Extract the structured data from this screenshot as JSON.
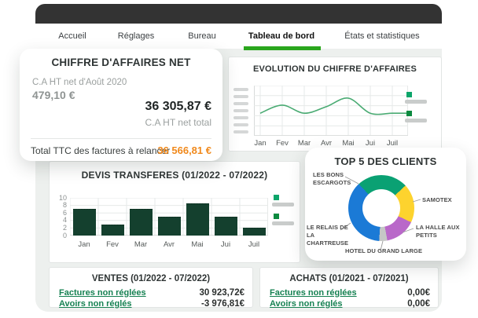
{
  "nav": {
    "tabs": [
      {
        "label": "Accueil",
        "active": false
      },
      {
        "label": "Réglages",
        "active": false
      },
      {
        "label": "Bureau",
        "active": false
      },
      {
        "label": "Tableau de bord",
        "active": true
      },
      {
        "label": "États et statistiques",
        "active": false
      }
    ]
  },
  "colors": {
    "accent_green": "#2aa61d",
    "orange": "#f0891c",
    "link_green": "#168152",
    "line_green": "#4aab73",
    "bar_green": "#14402e",
    "legend": [
      "#0ca56a",
      "#0c8a3f"
    ],
    "donut": [
      "#0aa173",
      "#fdd32e",
      "#b968c9",
      "#c5c7c6",
      "#1b7ad6"
    ]
  },
  "ca_card": {
    "title": "CHIFFRE D'AFFAIRES NET",
    "month_label": "C.A HT net d'Août 2020",
    "month_value": "479,10 €",
    "total_value": "36 305,87 €",
    "total_label": "C.A HT net total",
    "relance_label": "Total TTC des factures à relancer",
    "relance_value": "36 566,81 €"
  },
  "evolution": {
    "title": "EVOLUTION DU CHIFFRE D'AFFAIRES",
    "months": [
      "Jan",
      "Fev",
      "Mar",
      "Avr",
      "Mai",
      "Jui",
      "Juil"
    ],
    "values_relative": [
      0.45,
      0.61,
      0.45,
      0.58,
      0.75,
      0.45,
      0.45
    ]
  },
  "devis": {
    "title": "DEVIS TRANSFERES (01/2022 - 07/2022)",
    "months": [
      "Jan",
      "Fev",
      "Mar",
      "Avr",
      "Mai",
      "Jui",
      "Juil"
    ],
    "values": [
      7,
      3,
      7,
      5,
      8.5,
      5,
      2
    ],
    "yticks": [
      10,
      8,
      6,
      4,
      2,
      0
    ]
  },
  "top5": {
    "title": "TOP 5 DES CLIENTS",
    "clients": [
      {
        "name": "LES BONS ESCARGOTS",
        "color": "#0aa173",
        "pct": 25
      },
      {
        "name": "SAMOTEX",
        "color": "#fdd32e",
        "pct": 19
      },
      {
        "name": "LA HALLE AUX PETITS",
        "color": "#b968c9",
        "pct": 15
      },
      {
        "name": "HOTEL DU GRAND LARGE",
        "color": "#c5c7c6",
        "pct": 4
      },
      {
        "name": "LE RELAIS DE LA CHARTREUSE",
        "color": "#1b7ad6",
        "pct": 37
      }
    ]
  },
  "ventes": {
    "title": "VENTES (01/2022 - 07/2022)",
    "rows": [
      {
        "label": "Factures non réglées",
        "value": "30 923,72€"
      },
      {
        "label": "Avoirs non réglés",
        "value": "-3 976,81€"
      }
    ]
  },
  "achats": {
    "title": "ACHATS (01/2021 - 07/2021)",
    "rows": [
      {
        "label": "Factures non réglées",
        "value": "0,00€"
      },
      {
        "label": "Avoirs non réglés",
        "value": "0,00€"
      }
    ]
  },
  "chart_data": [
    {
      "type": "line",
      "title": "EVOLUTION DU CHIFFRE D'AFFAIRES",
      "x": [
        "Jan",
        "Fev",
        "Mar",
        "Avr",
        "Mai",
        "Jui",
        "Juil"
      ],
      "series": [
        {
          "name": "(legend text redacted as gray bar)",
          "values_relative": [
            0.45,
            0.61,
            0.45,
            0.58,
            0.75,
            0.45,
            0.45
          ]
        }
      ],
      "note": "y-axis tick labels and the two legend labels are redacted gray placeholder bars in the screenshot",
      "legend_position": "right",
      "grid": true
    },
    {
      "type": "bar",
      "title": "DEVIS TRANSFERES (01/2022 - 07/2022)",
      "categories": [
        "Jan",
        "Fev",
        "Mar",
        "Avr",
        "Mai",
        "Jui",
        "Juil"
      ],
      "values": [
        7,
        3,
        7,
        5,
        8.5,
        5,
        2
      ],
      "ylim": [
        0,
        10
      ],
      "yticks": [
        0,
        2,
        4,
        6,
        8,
        10
      ],
      "legend_position": "right",
      "grid": true
    },
    {
      "type": "pie",
      "title": "TOP 5 DES CLIENTS",
      "labels": [
        "LES BONS ESCARGOTS",
        "SAMOTEX",
        "LA HALLE AUX PETITS",
        "HOTEL DU GRAND LARGE",
        "LE RELAIS DE LA CHARTREUSE"
      ],
      "values_pct": [
        25,
        19,
        15,
        4,
        37
      ],
      "donut": true
    }
  ]
}
